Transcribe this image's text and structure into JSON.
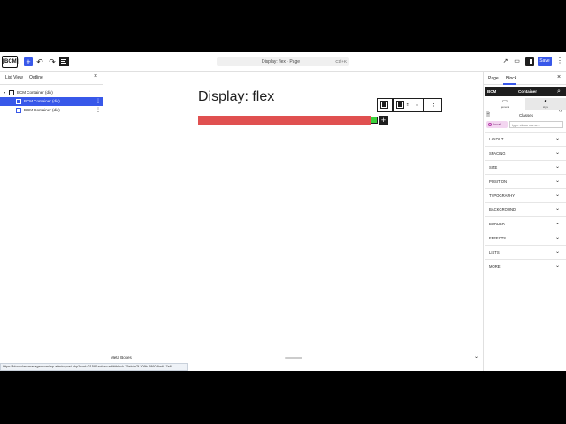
{
  "topbar": {
    "logo": "[BCM]",
    "add_icon": "+",
    "undo_icon": "↶",
    "redo_icon": "↷",
    "command": {
      "title": "Display: flex · Page",
      "shortcut": "Ctrl+K"
    },
    "save_label": "Save",
    "more_icon": "⋮"
  },
  "list_view": {
    "tabs": [
      "List View",
      "Outline"
    ],
    "close_icon": "×",
    "items": [
      {
        "label": "BCM Container (div)",
        "caret": "▾",
        "selected": false
      },
      {
        "label": "BCM Container (div)",
        "caret": "",
        "selected": true
      },
      {
        "label": "BCM Container (div)",
        "caret": "",
        "selected": false
      }
    ]
  },
  "canvas": {
    "heading": "Display: flex",
    "bar_color": "#e05050",
    "child_color": "#3bd13b",
    "add_block_icon": "+"
  },
  "meta": {
    "label": "Meta Boxes",
    "chevron": "⌄"
  },
  "status_url": "https://blockclassmanager.com/wp-admin/post.php?post=2158&action=edit#block-75eb4a7f-309b-4860-9ad8-7e6...",
  "sidebar": {
    "tabs": [
      "Page",
      "Block"
    ],
    "close_icon": "×",
    "header": {
      "left": "BCM",
      "title": "Container"
    },
    "modes": [
      {
        "icon": "▭",
        "label": "general"
      },
      {
        "icon": "◐",
        "label": "style"
      }
    ],
    "classes_label": "Classes",
    "local_badge": "local",
    "class_placeholder": "type class name...",
    "sections": [
      "LAYOUT",
      "SPACING",
      "SIZE",
      "POSITION",
      "TYPOGRAPHY",
      "BACKGROUND",
      "BORDER",
      "EFFECTS",
      "LISTS",
      "MORE"
    ]
  },
  "accent_color": "#3858e9"
}
